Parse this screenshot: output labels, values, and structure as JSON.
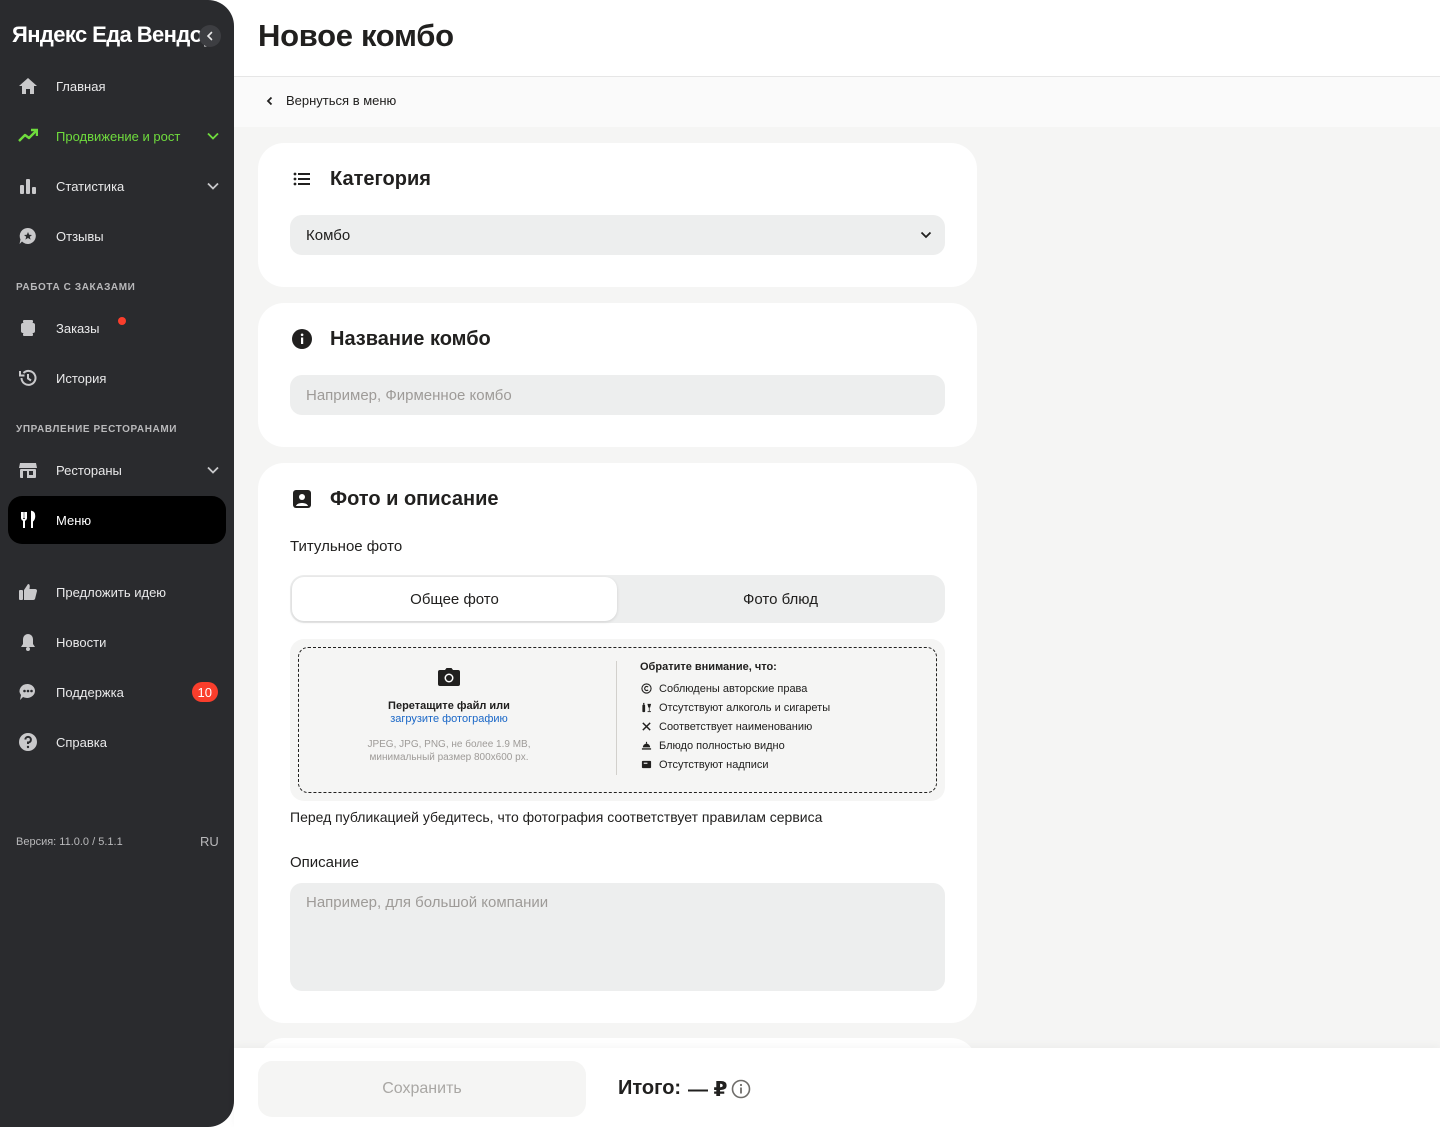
{
  "app": {
    "brand": "Яндекс Еда Вендор"
  },
  "sidebar": {
    "items": [
      {
        "label": "Главная",
        "icon": "home-icon"
      },
      {
        "label": "Продвижение и рост",
        "icon": "trending-up-icon"
      },
      {
        "label": "Статистика",
        "icon": "bar-chart-icon"
      },
      {
        "label": "Отзывы",
        "icon": "chat-star-icon"
      },
      {
        "label": "Заказы",
        "icon": "orders-icon"
      },
      {
        "label": "История",
        "icon": "history-icon"
      },
      {
        "label": "Рестораны",
        "icon": "store-icon"
      },
      {
        "label": "Меню",
        "icon": "fork-knife-icon"
      },
      {
        "label": "Предложить идею",
        "icon": "thumbs-up-icon"
      },
      {
        "label": "Новости",
        "icon": "bell-icon"
      },
      {
        "label": "Поддержка",
        "icon": "support-chat-icon",
        "badge": "10"
      },
      {
        "label": "Справка",
        "icon": "help-icon"
      }
    ],
    "sections": {
      "orders": "Работа с заказами",
      "restaurants": "Управление ресторанами"
    },
    "version": "Версия: 11.0.0 / 5.1.1",
    "lang": "RU"
  },
  "header": {
    "title": "Новое комбо"
  },
  "back_link": "Вернуться в меню",
  "category": {
    "title": "Категория",
    "value": "Комбо"
  },
  "name_section": {
    "title": "Название комбо",
    "placeholder": "Например, Фирменное комбо"
  },
  "photo_section": {
    "title": "Фото и описание",
    "cover_label": "Титульное фото",
    "tabs": [
      "Общее фото",
      "Фото блюд"
    ],
    "upload": {
      "drag_text": "Перетащите файл или",
      "upload_link": "загрузите фотографию",
      "formats": "JPEG, JPG, PNG, не более 1.9 MB,",
      "min_size": "минимальный размер 800x600 px.",
      "notice_title": "Обратите внимание, что:",
      "rules": [
        "Соблюдены авторские права",
        "Отсутствуют алкоголь и сигареты",
        "Соответствует наименованию",
        "Блюдо полностью видно",
        "Отсутствуют надписи"
      ]
    },
    "note": "Перед публикацией убедитесь, что фотография соответствует правилам сервиса",
    "description_label": "Описание",
    "description_placeholder": "Например, для большой компании"
  },
  "footer": {
    "save": "Сохранить",
    "total_label": "Итого:",
    "total_value": "— ₽"
  },
  "colors": {
    "sidebar_bg": "#2a2b2e",
    "accent_green": "#6fdc3d",
    "badge_red": "#fa3e2c",
    "link_blue": "#1a67c7"
  }
}
